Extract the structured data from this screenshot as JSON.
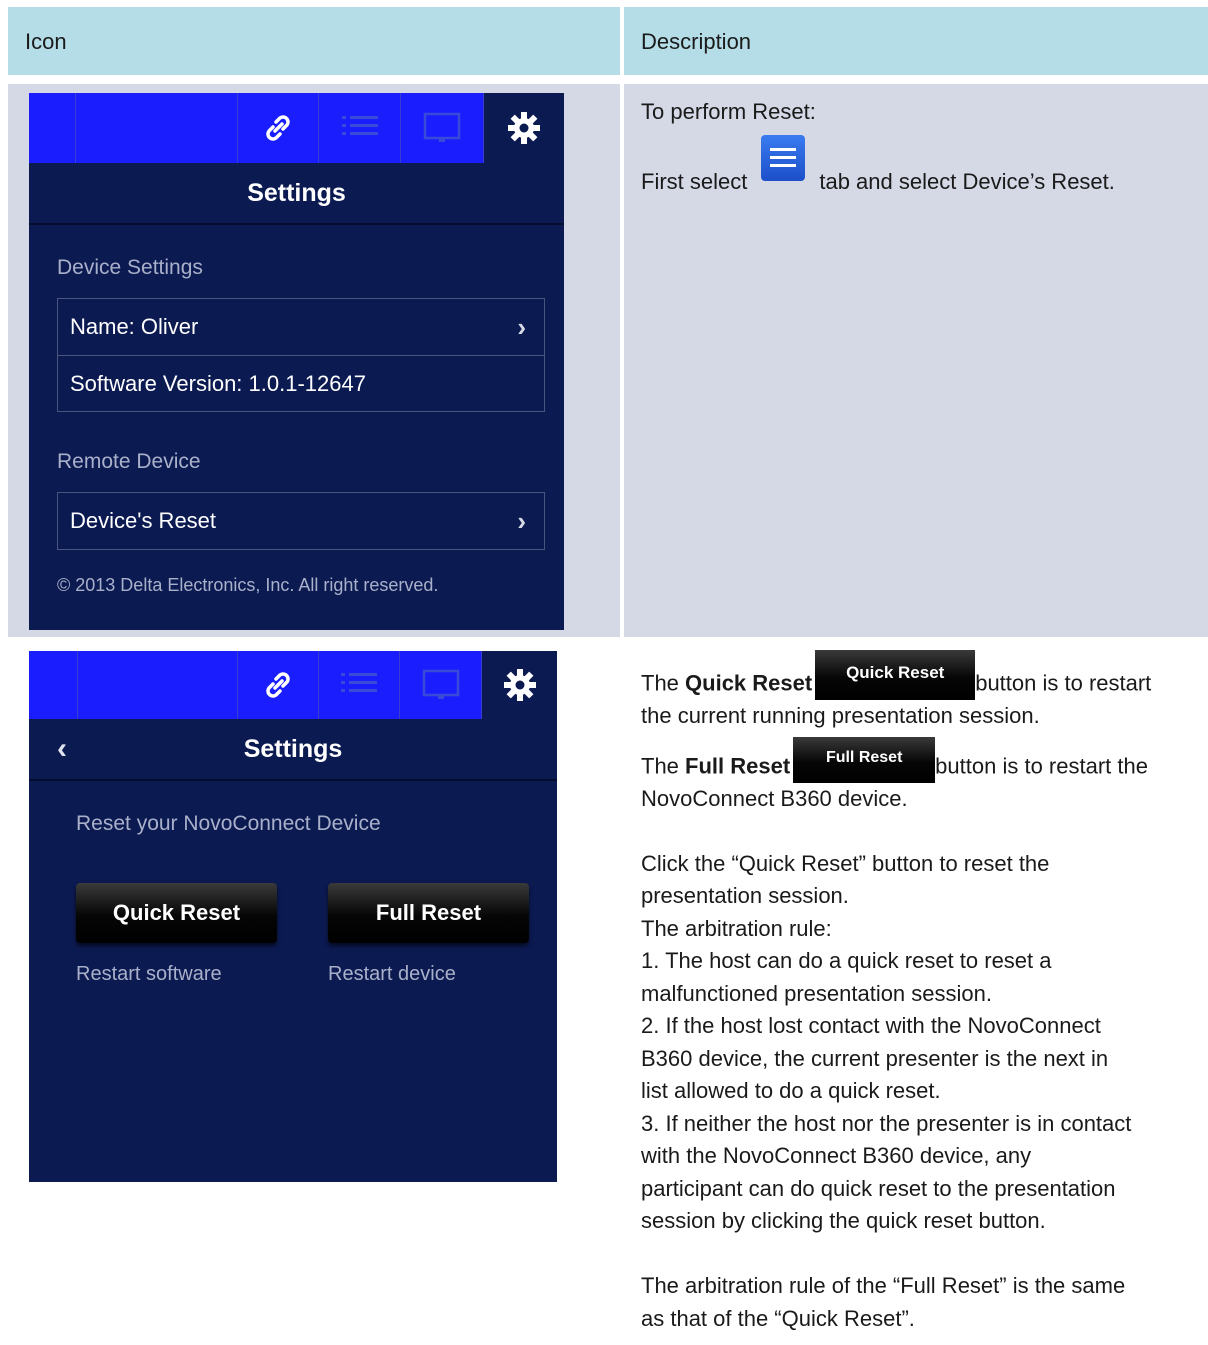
{
  "table": {
    "header": {
      "col1": "Icon",
      "col2": "Description"
    }
  },
  "row1": {
    "screen": {
      "tab_icons": [
        "link-icon",
        "list-icon",
        "screen-icon",
        "gear-icon"
      ],
      "title": "Settings",
      "device_settings_label": "Device Settings",
      "name_item": "Name: Oliver",
      "version_item": "Software Version: 1.0.1-12647",
      "remote_device_label": "Remote Device",
      "reset_item": "Device's Reset",
      "copyright": "© 2013 Delta Electronics, Inc. All right reserved."
    },
    "desc": {
      "line1": "To perform Reset:",
      "line2_a": "First select",
      "line2_b": "tab and select Device’s Reset."
    }
  },
  "row2": {
    "screen": {
      "title": "Settings",
      "back": "‹",
      "section_label": "Reset your NovoConnect Device",
      "quick_reset_button": "Quick Reset",
      "full_reset_button": "Full Reset",
      "quick_reset_sub": "Restart software",
      "full_reset_sub": "Restart device"
    },
    "desc": {
      "p1_a": "The ",
      "p1_b": "Quick Reset",
      "p1_btn": "Quick Reset",
      "p1_c": "button is to restart",
      "p1_d": "the current running presentation session.",
      "p2_a": "The ",
      "p2_b": "Full Reset",
      "p2_btn": "Full Reset",
      "p2_c": "button is to restart the",
      "p2_d": "NovoConnect B360 device.",
      "lines": [
        "Click the “Quick Reset” button to reset the",
        "presentation session.",
        "The arbitration rule:",
        "1. The host can do a quick reset to reset a",
        "malfunctioned presentation session.",
        "2. If the host lost contact with the NovoConnect",
        "B360 device, the current presenter is the next in",
        "list allowed to do a quick reset.",
        "3. If neither the host nor the presenter is in contact",
        "with the NovoConnect B360 device, any",
        "participant can do quick reset to the presentation",
        "session by clicking the quick reset button."
      ],
      "final_1": "The arbitration rule of the “Full Reset” is the same",
      "final_2": "as that of the “Quick Reset”."
    }
  }
}
